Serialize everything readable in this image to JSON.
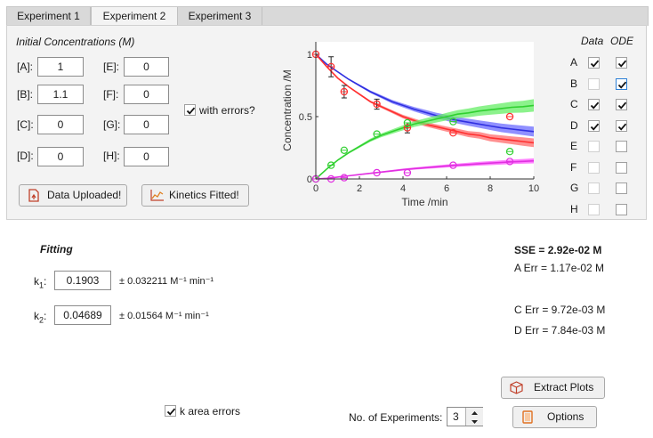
{
  "tabs": [
    {
      "label": "Experiment 1"
    },
    {
      "label": "Experiment 2"
    },
    {
      "label": "Experiment 3"
    }
  ],
  "concentrations": {
    "title": "Initial Concentrations (M)",
    "fields": [
      {
        "label": "[A]:",
        "value": "1"
      },
      {
        "label": "[B]:",
        "value": "1.1"
      },
      {
        "label": "[C]:",
        "value": "0"
      },
      {
        "label": "[D]:",
        "value": "0"
      },
      {
        "label": "[E]:",
        "value": "0"
      },
      {
        "label": "[F]:",
        "value": "0"
      },
      {
        "label": "[G]:",
        "value": "0"
      },
      {
        "label": "[H]:",
        "value": "0"
      }
    ],
    "with_errors_label": "with errors?",
    "with_errors_checked": true
  },
  "buttons": {
    "data_uploaded": "Data Uploaded!",
    "kinetics_fitted": "Kinetics Fitted!",
    "extract_plots": "Extract Plots",
    "options": "Options"
  },
  "species_table": {
    "header_data": "Data",
    "header_ode": "ODE",
    "rows": [
      {
        "species": "A",
        "data": true,
        "ode": true
      },
      {
        "species": "B",
        "data": false,
        "ode": true
      },
      {
        "species": "C",
        "data": true,
        "ode": true
      },
      {
        "species": "D",
        "data": true,
        "ode": true
      },
      {
        "species": "E",
        "data": false,
        "ode": false
      },
      {
        "species": "F",
        "data": false,
        "ode": false
      },
      {
        "species": "G",
        "data": false,
        "ode": false
      },
      {
        "species": "H",
        "data": false,
        "ode": false
      }
    ]
  },
  "fitting": {
    "title": "Fitting",
    "k1_label": "k",
    "k1_sub": "1",
    "k1_value": "0.1903",
    "k1_error": "± 0.032211 M⁻¹ min⁻¹",
    "k2_label": "k",
    "k2_sub": "2",
    "k2_value": "0.04689",
    "k2_error": "± 0.01564 M⁻¹ min⁻¹"
  },
  "errors": {
    "sse": "SSE = 2.92e-02 M",
    "a_err": "A Err = 1.17e-02 M",
    "c_err": "C Err = 9.72e-03 M",
    "d_err": "D Err = 7.84e-03 M"
  },
  "bottom": {
    "k_area_errors_label": "k area errors",
    "k_area_errors_checked": true,
    "num_experiments_label": "No. of Experiments:",
    "num_experiments_value": "3"
  },
  "colors": {
    "A": "#3030e0",
    "A_band": "#6b6bff",
    "B": "#ff3030",
    "B_band": "#ff6b6b",
    "C": "#30d030",
    "C_band": "#66ee66",
    "D": "#e030e0",
    "D_band": "#ff55ff"
  },
  "chart_data": {
    "type": "line",
    "xlabel": "Time /min",
    "ylabel": "Concentration /M",
    "xlim": [
      0,
      10
    ],
    "ylim": [
      0,
      1.1
    ],
    "xticks": [
      "0",
      "2",
      "4",
      "6",
      "8",
      "10"
    ],
    "yticks": [
      "0",
      "0.5",
      "1"
    ],
    "series": [
      {
        "key": "A",
        "x": [
          0,
          0.5,
          1,
          1.5,
          2,
          2.5,
          3,
          3.5,
          4,
          4.5,
          5,
          5.5,
          6,
          6.5,
          7,
          7.5,
          8,
          8.5,
          9,
          9.5,
          10
        ],
        "y": [
          1.0,
          0.92,
          0.86,
          0.8,
          0.75,
          0.7,
          0.66,
          0.62,
          0.59,
          0.56,
          0.535,
          0.51,
          0.49,
          0.47,
          0.455,
          0.44,
          0.425,
          0.41,
          0.4,
          0.39,
          0.38
        ],
        "band": 0.04
      },
      {
        "key": "B",
        "x": [
          0,
          0.5,
          1,
          1.5,
          2,
          2.5,
          3,
          3.5,
          4,
          4.5,
          5,
          5.5,
          6,
          6.5,
          7,
          7.5,
          8,
          8.5,
          9,
          9.5,
          10
        ],
        "y": [
          1.0,
          0.9,
          0.81,
          0.74,
          0.68,
          0.62,
          0.58,
          0.54,
          0.5,
          0.47,
          0.44,
          0.42,
          0.4,
          0.38,
          0.36,
          0.35,
          0.33,
          0.32,
          0.31,
          0.3,
          0.29
        ],
        "band": 0.035
      },
      {
        "key": "C",
        "x": [
          0,
          0.5,
          1,
          1.5,
          2,
          2.5,
          3,
          3.5,
          4,
          4.5,
          5,
          5.5,
          6,
          6.5,
          7,
          7.5,
          8,
          8.5,
          9,
          9.5,
          10
        ],
        "y": [
          0,
          0.08,
          0.15,
          0.21,
          0.26,
          0.31,
          0.35,
          0.38,
          0.41,
          0.44,
          0.46,
          0.48,
          0.5,
          0.52,
          0.53,
          0.545,
          0.555,
          0.565,
          0.575,
          0.58,
          0.59
        ],
        "band": 0.05
      },
      {
        "key": "D",
        "x": [
          0,
          0.5,
          1,
          1.5,
          2,
          2.5,
          3,
          3.5,
          4,
          4.5,
          5,
          5.5,
          6,
          6.5,
          7,
          7.5,
          8,
          8.5,
          9,
          9.5,
          10
        ],
        "y": [
          0,
          0.005,
          0.015,
          0.025,
          0.035,
          0.045,
          0.055,
          0.065,
          0.075,
          0.083,
          0.09,
          0.097,
          0.104,
          0.11,
          0.116,
          0.122,
          0.127,
          0.132,
          0.137,
          0.141,
          0.145
        ],
        "band": 0.02
      }
    ],
    "points": [
      {
        "key": "A",
        "x": [
          0,
          0.7,
          1.3,
          2.8,
          4.2,
          6.3,
          8.9
        ],
        "y": [
          1.0,
          0.9,
          0.7,
          0.6,
          0.41,
          0.37,
          0.5
        ],
        "err": [
          0,
          0.08,
          0.05,
          0.04,
          0.04,
          0,
          0
        ]
      },
      {
        "key": "C",
        "x": [
          0,
          0.7,
          1.3,
          2.8,
          4.2,
          6.3,
          8.9
        ],
        "y": [
          0,
          0.11,
          0.23,
          0.36,
          0.45,
          0.46,
          0.22
        ],
        "err": [
          0,
          0,
          0,
          0,
          0,
          0,
          0
        ]
      },
      {
        "key": "D",
        "x": [
          0,
          0.7,
          1.3,
          2.8,
          4.2,
          6.3,
          8.9
        ],
        "y": [
          0,
          0.0,
          0.01,
          0.05,
          0.05,
          0.11,
          0.14
        ],
        "err": [
          0,
          0,
          0,
          0,
          0,
          0,
          0
        ]
      }
    ]
  }
}
